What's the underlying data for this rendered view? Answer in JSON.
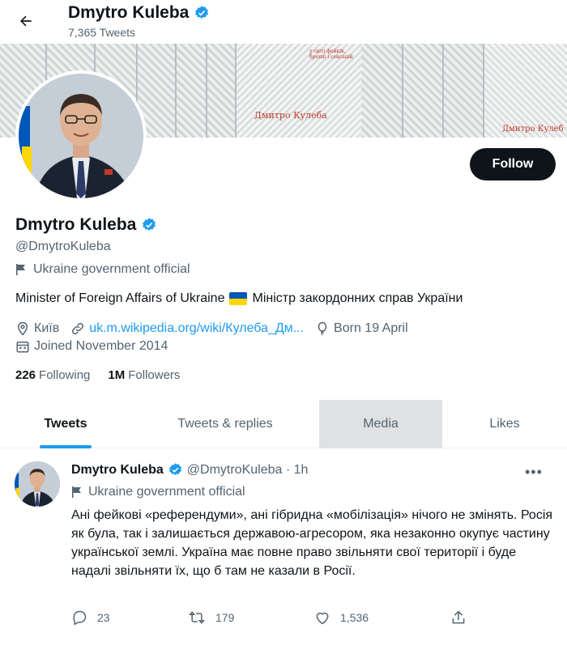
{
  "header": {
    "name": "Dmytro Kuleba",
    "tweet_count": "7,365 Tweets"
  },
  "banner": {
    "cover_title": "Дмитро Кулеба",
    "cover_subtitle": "у світі фейків, брехні і сенсацій",
    "cover_title_right": "Дмитро Кулеб"
  },
  "profile": {
    "follow_label": "Follow",
    "name": "Dmytro Kuleba",
    "handle": "@DmytroKuleba",
    "label": "Ukraine government official",
    "bio_before": "Minister of Foreign Affairs of Ukraine",
    "bio_after": "Міністр закордонних справ України",
    "location": "Київ",
    "website": "uk.m.wikipedia.org/wiki/Кулеба_Дм...",
    "birthday": "Born 19 April",
    "joined": "Joined November 2014",
    "following_count": "226",
    "following_label": "Following",
    "followers_count": "1M",
    "followers_label": "Followers"
  },
  "tabs": [
    {
      "label": "Tweets",
      "state": "active"
    },
    {
      "label": "Tweets & replies",
      "state": ""
    },
    {
      "label": "Media",
      "state": "hover"
    },
    {
      "label": "Likes",
      "state": ""
    }
  ],
  "tweet": {
    "name": "Dmytro Kuleba",
    "handle_time": "@DmytroKuleba · 1h",
    "label": "Ukraine government official",
    "text": "Ані фейкові «референдуми», ані гібридна «мобілізація» нічого не змінять. Росія як була, так і залишається державою-агресором, яка незаконно окупує частину української землі. Україна має повне право звільняти свої території і буде надалі звільняти їх, що б там не казали в Росії.",
    "replies": "23",
    "retweets": "179",
    "likes": "1,536"
  },
  "icons": {
    "back": "back-arrow-icon",
    "verified": "verified-badge-icon",
    "label": "flag-icon",
    "location": "location-pin-icon",
    "link": "link-icon",
    "birthday": "balloon-icon",
    "joined": "calendar-icon",
    "reply": "reply-icon",
    "retweet": "retweet-icon",
    "like": "heart-icon",
    "share": "share-icon",
    "more": "more-icon"
  },
  "colors": {
    "accent": "#1d9bf0",
    "text": "#0f1419",
    "muted": "#536471",
    "follow_bg": "#0f1419"
  }
}
